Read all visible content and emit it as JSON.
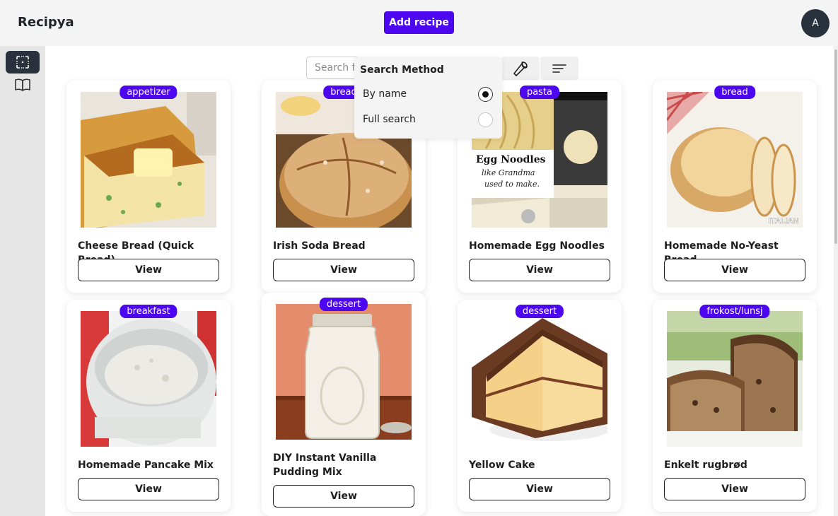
{
  "header": {
    "title": "Recipya",
    "add_recipe_label": "Add recipe",
    "avatar_initial": "A"
  },
  "sidebar": {
    "items": [
      {
        "icon": "select-icon",
        "active": true
      },
      {
        "icon": "book-icon",
        "active": false
      }
    ]
  },
  "toolbar": {
    "search_placeholder": "Search for recipes...",
    "tools_icon": "wrench-icon",
    "sort_icon": "sort-lines-icon"
  },
  "search_method": {
    "title": "Search Method",
    "options": [
      {
        "label": "By name",
        "selected": true
      },
      {
        "label": "Full search",
        "selected": false
      }
    ]
  },
  "recipes": [
    {
      "category": "appetizer",
      "name": "Cheese Bread (Quick Bread)",
      "view_label": "View"
    },
    {
      "category": "bread",
      "name": "Irish Soda Bread",
      "view_label": "View"
    },
    {
      "category": "pasta",
      "name": "Homemade Egg Noodles",
      "view_label": "View",
      "image_text": [
        "Egg Noodles",
        "like Grandma",
        "used to make."
      ]
    },
    {
      "category": "bread",
      "name": "Homemade No-Yeast Bread",
      "view_label": "View",
      "image_text": [
        "ITALIAN"
      ]
    },
    {
      "category": "breakfast",
      "name": "Homemade Pancake Mix",
      "view_label": "View"
    },
    {
      "category": "dessert",
      "name": "DIY Instant Vanilla Pudding Mix",
      "view_label": "View"
    },
    {
      "category": "dessert",
      "name": "Yellow Cake",
      "view_label": "View"
    },
    {
      "category": "frokost/lunsj",
      "name": "Enkelt rugbrød",
      "view_label": "View"
    }
  ],
  "colors": {
    "accent": "#4c06f0",
    "dark": "#29313d"
  }
}
